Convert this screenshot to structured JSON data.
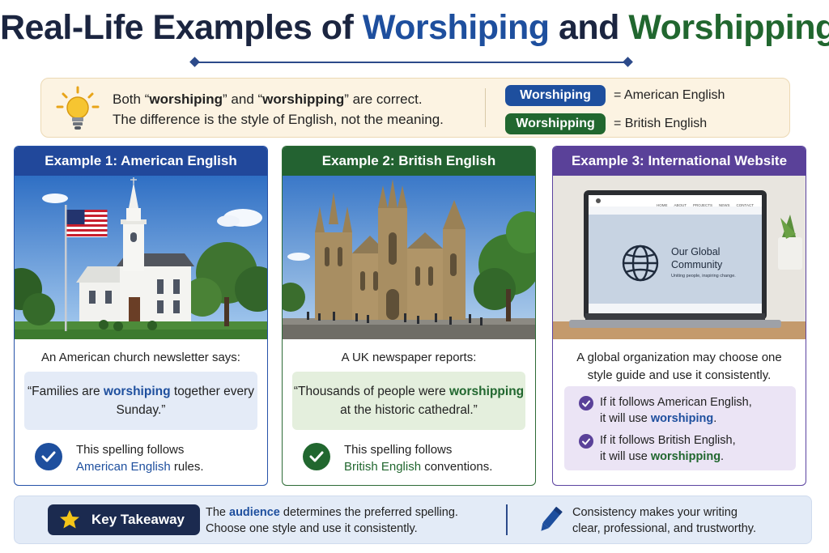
{
  "title": {
    "prefix": "Real-Life Examples of ",
    "word_us": "Worshiping",
    "mid": " and ",
    "word_uk": "Worshipping"
  },
  "intro": {
    "line1_a": "Both “",
    "line1_word1": "worshiping",
    "line1_b": "” and “",
    "line1_word2": "worshipping",
    "line1_c": "” are correct.",
    "line2": "The difference is the style of English, not the meaning.",
    "pill_us": "Worshiping",
    "pill_us_eq": "= American English",
    "pill_uk": "Worshipping",
    "pill_uk_eq": "= British English"
  },
  "cards": [
    {
      "header": "Example 1: American English",
      "lead": "An American church newsletter says:",
      "quote_a": "“Families are ",
      "quote_word": "worshiping",
      "quote_b": " together every Sunday.”",
      "rule_a": "This spelling follows",
      "rule_em": "American English",
      "rule_b": " rules."
    },
    {
      "header": "Example 2: British English",
      "lead": "A UK newspaper reports:",
      "quote_a": "“Thousands of people were ",
      "quote_word": "worshipping",
      "quote_b": " at the historic cathedral.”",
      "rule_a": "This spelling follows",
      "rule_em": "British English",
      "rule_b": " conventions."
    },
    {
      "header": "Example 3: International Website",
      "lead": "A global organization may choose one style guide and use it consistently.",
      "site_nav": [
        "HOME",
        "ABOUT",
        "PROJECTS",
        "NEWS",
        "CONTACT"
      ],
      "site_title_1": "Our Global",
      "site_title_2": "Community",
      "site_tagline": "Uniting people, inspiring change.",
      "row1_a": "If it follows American English,",
      "row1_b": "it will use ",
      "row1_word": "worshiping",
      "row1_end": ".",
      "row2_a": "If it follows British English,",
      "row2_b": "it will use ",
      "row2_word": "worshipping",
      "row2_end": "."
    }
  ],
  "takeaway": {
    "badge": "Key Takeaway",
    "t1_a": "The ",
    "t1_em": "audience",
    "t1_b": " determines the preferred spelling.",
    "t1_line2": "Choose one style and use it consistently.",
    "t2_line1": "Consistency makes your writing",
    "t2_line2": "clear, professional, and trustworthy."
  },
  "colors": {
    "american_blue": "#1e4f9e",
    "british_green": "#21672f",
    "international_purple": "#5a4199"
  }
}
